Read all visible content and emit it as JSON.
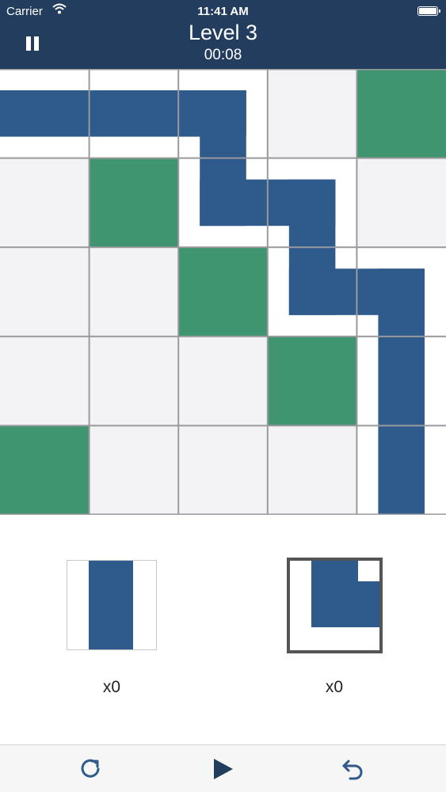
{
  "status_bar": {
    "carrier": "Carrier",
    "time": "11:41 AM"
  },
  "header": {
    "level": "Level 3",
    "timer": "00:08",
    "pause_icon": "pause-icon"
  },
  "colors": {
    "header_bg": "#233d5e",
    "path_blue": "#2e5a8c",
    "goal_green": "#3e9570",
    "empty_cell": "#f3f3f5"
  },
  "board": {
    "rows": 5,
    "cols": 5,
    "cells": [
      [
        "straight-horizontal",
        "straight-horizontal",
        "corner-left-bottom",
        "empty",
        "goal"
      ],
      [
        "empty",
        "goal",
        "corner-top-right",
        "corner-left-bottom",
        "empty"
      ],
      [
        "empty",
        "empty",
        "goal",
        "corner-top-right",
        "corner-left-bottom"
      ],
      [
        "empty",
        "empty",
        "empty",
        "goal",
        "straight-vertical"
      ],
      [
        "goal",
        "empty",
        "empty",
        "empty",
        "straight-vertical"
      ]
    ]
  },
  "pieces": [
    {
      "type": "straight-vertical",
      "count": "x0",
      "selected": false
    },
    {
      "type": "corner-top-right",
      "count": "x0",
      "selected": true
    }
  ],
  "toolbar": {
    "restart_icon": "restart-icon",
    "play_icon": "play-icon",
    "undo_icon": "undo-icon"
  }
}
